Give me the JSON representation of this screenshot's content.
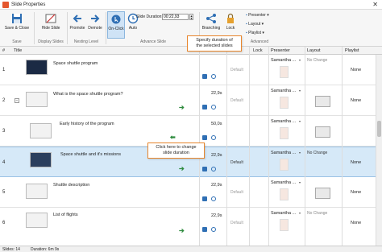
{
  "window": {
    "title": "Slide Properties",
    "close_glyph": "✕"
  },
  "ribbon": {
    "save_close": "Save & Close",
    "hide_slide": "Hide Slide",
    "promote": "Promote",
    "demote": "Demote",
    "on_click": "On-Click",
    "auto": "Auto",
    "slide_duration_label": "Slide Duration:",
    "slide_duration_value": "00:22,93",
    "branching": "Branching",
    "lock": "Lock",
    "presenter": "Presenter",
    "layout": "Layout",
    "playlist": "Playlist",
    "groups": {
      "save": "Save",
      "display": "Display Slides",
      "nesting": "Nesting Level",
      "advance": "Advance Slide",
      "advanced": "Advanced"
    }
  },
  "tooltips": {
    "duration_1": "Specify duration of",
    "duration_2": "the selected slides",
    "change_1": "Click here to change",
    "change_2": "slide duration"
  },
  "columns": {
    "num": "#",
    "title": "Title",
    "duration": "Duration",
    "lock": "Lock",
    "presenter": "Presenter",
    "layout": "Layout",
    "playlist": "Playlist"
  },
  "rows": [
    {
      "num": "1",
      "title": "Space shuttle program",
      "duration": "",
      "default": "Default",
      "presenter": "Samantha ...",
      "layout": "No Change",
      "playlist": "None"
    },
    {
      "num": "2",
      "title": "What is the space shuttle program?",
      "duration": "22,9s",
      "default": "Default",
      "presenter": "Samantha ...",
      "layout": "",
      "playlist": "None"
    },
    {
      "num": "3",
      "title": "Early history of the program",
      "duration": "50,0s",
      "default": "",
      "presenter": "Samantha ...",
      "layout": "",
      "playlist": ""
    },
    {
      "num": "4",
      "title": "Space shuttle and it's missions",
      "duration": "22,9s",
      "default": "Default",
      "presenter": "Samantha ...",
      "layout": "No Change",
      "playlist": "None"
    },
    {
      "num": "5",
      "title": "Shuttle description",
      "duration": "22,9s",
      "default": "Default",
      "presenter": "Samantha ...",
      "layout": "",
      "playlist": "None"
    },
    {
      "num": "6",
      "title": "List of flights",
      "duration": "22,9s",
      "default": "Default",
      "presenter": "Samantha ...",
      "layout": "No Change",
      "playlist": "None"
    }
  ],
  "status": {
    "slides": "Slides: 14",
    "duration": "Duration: 6m 9s"
  }
}
